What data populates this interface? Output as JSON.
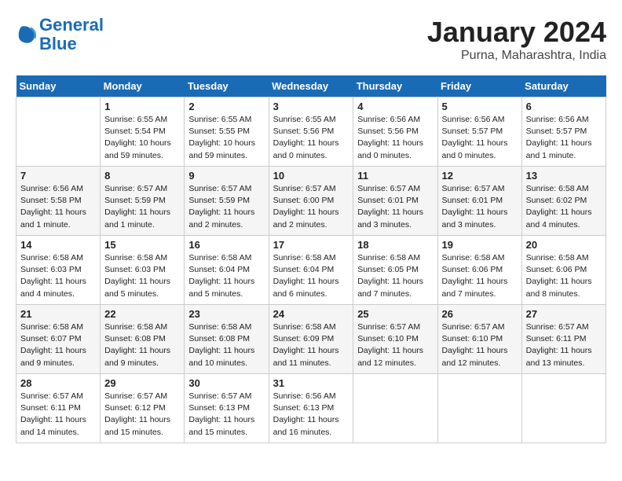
{
  "header": {
    "logo_line1": "General",
    "logo_line2": "Blue",
    "month": "January 2024",
    "location": "Purna, Maharashtra, India"
  },
  "weekdays": [
    "Sunday",
    "Monday",
    "Tuesday",
    "Wednesday",
    "Thursday",
    "Friday",
    "Saturday"
  ],
  "weeks": [
    [
      {
        "day": "",
        "info": ""
      },
      {
        "day": "1",
        "info": "Sunrise: 6:55 AM\nSunset: 5:54 PM\nDaylight: 10 hours\nand 59 minutes."
      },
      {
        "day": "2",
        "info": "Sunrise: 6:55 AM\nSunset: 5:55 PM\nDaylight: 10 hours\nand 59 minutes."
      },
      {
        "day": "3",
        "info": "Sunrise: 6:55 AM\nSunset: 5:56 PM\nDaylight: 11 hours\nand 0 minutes."
      },
      {
        "day": "4",
        "info": "Sunrise: 6:56 AM\nSunset: 5:56 PM\nDaylight: 11 hours\nand 0 minutes."
      },
      {
        "day": "5",
        "info": "Sunrise: 6:56 AM\nSunset: 5:57 PM\nDaylight: 11 hours\nand 0 minutes."
      },
      {
        "day": "6",
        "info": "Sunrise: 6:56 AM\nSunset: 5:57 PM\nDaylight: 11 hours\nand 1 minute."
      }
    ],
    [
      {
        "day": "7",
        "info": "Sunrise: 6:56 AM\nSunset: 5:58 PM\nDaylight: 11 hours\nand 1 minute."
      },
      {
        "day": "8",
        "info": "Sunrise: 6:57 AM\nSunset: 5:59 PM\nDaylight: 11 hours\nand 1 minute."
      },
      {
        "day": "9",
        "info": "Sunrise: 6:57 AM\nSunset: 5:59 PM\nDaylight: 11 hours\nand 2 minutes."
      },
      {
        "day": "10",
        "info": "Sunrise: 6:57 AM\nSunset: 6:00 PM\nDaylight: 11 hours\nand 2 minutes."
      },
      {
        "day": "11",
        "info": "Sunrise: 6:57 AM\nSunset: 6:01 PM\nDaylight: 11 hours\nand 3 minutes."
      },
      {
        "day": "12",
        "info": "Sunrise: 6:57 AM\nSunset: 6:01 PM\nDaylight: 11 hours\nand 3 minutes."
      },
      {
        "day": "13",
        "info": "Sunrise: 6:58 AM\nSunset: 6:02 PM\nDaylight: 11 hours\nand 4 minutes."
      }
    ],
    [
      {
        "day": "14",
        "info": "Sunrise: 6:58 AM\nSunset: 6:03 PM\nDaylight: 11 hours\nand 4 minutes."
      },
      {
        "day": "15",
        "info": "Sunrise: 6:58 AM\nSunset: 6:03 PM\nDaylight: 11 hours\nand 5 minutes."
      },
      {
        "day": "16",
        "info": "Sunrise: 6:58 AM\nSunset: 6:04 PM\nDaylight: 11 hours\nand 5 minutes."
      },
      {
        "day": "17",
        "info": "Sunrise: 6:58 AM\nSunset: 6:04 PM\nDaylight: 11 hours\nand 6 minutes."
      },
      {
        "day": "18",
        "info": "Sunrise: 6:58 AM\nSunset: 6:05 PM\nDaylight: 11 hours\nand 7 minutes."
      },
      {
        "day": "19",
        "info": "Sunrise: 6:58 AM\nSunset: 6:06 PM\nDaylight: 11 hours\nand 7 minutes."
      },
      {
        "day": "20",
        "info": "Sunrise: 6:58 AM\nSunset: 6:06 PM\nDaylight: 11 hours\nand 8 minutes."
      }
    ],
    [
      {
        "day": "21",
        "info": "Sunrise: 6:58 AM\nSunset: 6:07 PM\nDaylight: 11 hours\nand 9 minutes."
      },
      {
        "day": "22",
        "info": "Sunrise: 6:58 AM\nSunset: 6:08 PM\nDaylight: 11 hours\nand 9 minutes."
      },
      {
        "day": "23",
        "info": "Sunrise: 6:58 AM\nSunset: 6:08 PM\nDaylight: 11 hours\nand 10 minutes."
      },
      {
        "day": "24",
        "info": "Sunrise: 6:58 AM\nSunset: 6:09 PM\nDaylight: 11 hours\nand 11 minutes."
      },
      {
        "day": "25",
        "info": "Sunrise: 6:57 AM\nSunset: 6:10 PM\nDaylight: 11 hours\nand 12 minutes."
      },
      {
        "day": "26",
        "info": "Sunrise: 6:57 AM\nSunset: 6:10 PM\nDaylight: 11 hours\nand 12 minutes."
      },
      {
        "day": "27",
        "info": "Sunrise: 6:57 AM\nSunset: 6:11 PM\nDaylight: 11 hours\nand 13 minutes."
      }
    ],
    [
      {
        "day": "28",
        "info": "Sunrise: 6:57 AM\nSunset: 6:11 PM\nDaylight: 11 hours\nand 14 minutes."
      },
      {
        "day": "29",
        "info": "Sunrise: 6:57 AM\nSunset: 6:12 PM\nDaylight: 11 hours\nand 15 minutes."
      },
      {
        "day": "30",
        "info": "Sunrise: 6:57 AM\nSunset: 6:13 PM\nDaylight: 11 hours\nand 15 minutes."
      },
      {
        "day": "31",
        "info": "Sunrise: 6:56 AM\nSunset: 6:13 PM\nDaylight: 11 hours\nand 16 minutes."
      },
      {
        "day": "",
        "info": ""
      },
      {
        "day": "",
        "info": ""
      },
      {
        "day": "",
        "info": ""
      }
    ]
  ]
}
